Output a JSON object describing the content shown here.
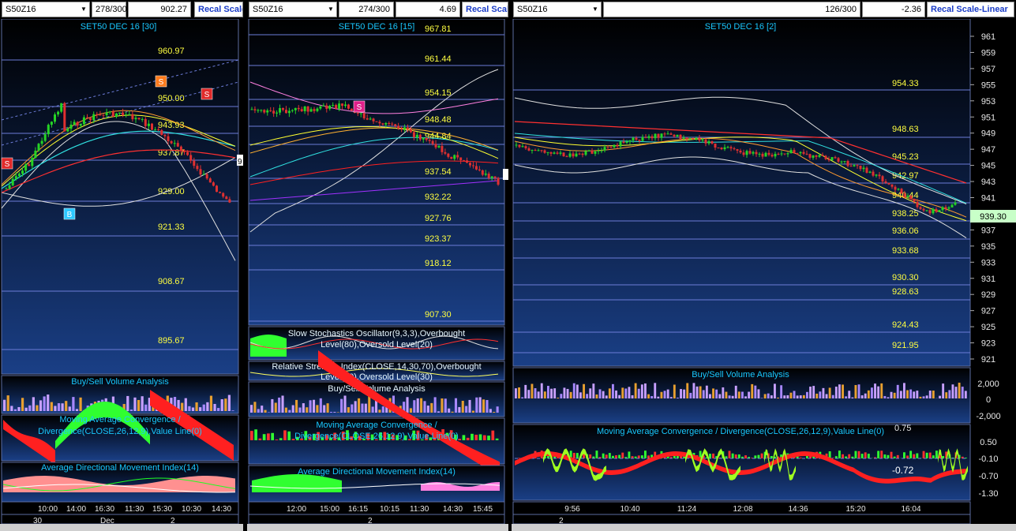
{
  "panes": [
    {
      "symbol": "S50Z16",
      "count": "278/300",
      "value": "902.27",
      "recal": "Recal Scale",
      "title": "SET50 DEC 16  [30]",
      "price_labels": [
        "960.97",
        "950.00",
        "943.93",
        "937.87",
        "929.00",
        "921.33",
        "908.67",
        "895.67"
      ],
      "side_label": "9",
      "signals": [
        "S",
        "S",
        "B"
      ],
      "indicators": [
        "Buy/Sell Volume Analysis",
        "Moving Average Convergence /",
        "Divergence(CLOSE,26,12,9),Value Line(0)",
        "Average Directional Movement Index(14)"
      ],
      "time_labels": [
        "10:00",
        "14:00",
        "16:30",
        "11:30",
        "15:30",
        "10:30",
        "14:30"
      ],
      "date_labels": [
        "30",
        "Dec",
        "2"
      ]
    },
    {
      "symbol": "S50Z16",
      "count": "274/300",
      "value": "4.69",
      "recal": "Recal Scale",
      "title": "SET50 DEC 16  [15]",
      "price_labels": [
        "967.81",
        "961.44",
        "954.15",
        "948.48",
        "944.84",
        "937.54",
        "932.22",
        "927.76",
        "923.37",
        "918.12",
        "907.30"
      ],
      "signals": [
        "S"
      ],
      "indicators": [
        "Slow Stochastics Oscillator(9,3,3),Overbought",
        "Level(80),Oversold Level(20)",
        "Relative Strength Index(CLOSE,14,30,70),Overbought",
        "Level(70),Oversold Level(30)",
        "Buy/Sell Volume Analysis",
        "Moving Average Convergence /",
        "Divergence(CLOSE,26,12,9),Value Line(0)",
        "Average Directional Movement Index(14)"
      ],
      "time_labels": [
        "12:00",
        "15:00",
        "16:15",
        "10:15",
        "11:30",
        "14:30",
        "15:45"
      ],
      "date_labels": [
        "2"
      ]
    },
    {
      "symbol": "S50Z16",
      "count": "126/300",
      "value": "-2.36",
      "recal": "Recal Scale-Linear",
      "title": "SET50 DEC 16  [2]",
      "price_labels": [
        "954.33",
        "948.63",
        "945.23",
        "942.97",
        "940.44",
        "938.25",
        "936.06",
        "933.68",
        "930.30",
        "928.63",
        "924.43",
        "921.95"
      ],
      "axis_labels": [
        "961",
        "959",
        "957",
        "955",
        "953",
        "951",
        "949",
        "947",
        "945",
        "943",
        "941",
        "939",
        "937",
        "935",
        "933",
        "931",
        "929",
        "927",
        "925",
        "923",
        "921"
      ],
      "last_price": "939.30",
      "indicators": [
        "Buy/Sell Volume Analysis",
        "Moving Average Convergence / Divergence(CLOSE,26,12,9),Value Line(0)"
      ],
      "vol_axis": [
        "2,000",
        "0",
        "-2,000"
      ],
      "macd_axis": [
        "0.50",
        "-0.10",
        "-0.70",
        "-1.30"
      ],
      "macd_value": "-0.72",
      "macd_top": "0.75",
      "time_labels": [
        "9:56",
        "10:40",
        "11:24",
        "12:08",
        "14:36",
        "15:20",
        "16:04"
      ],
      "date_labels": [
        "2"
      ]
    }
  ]
}
